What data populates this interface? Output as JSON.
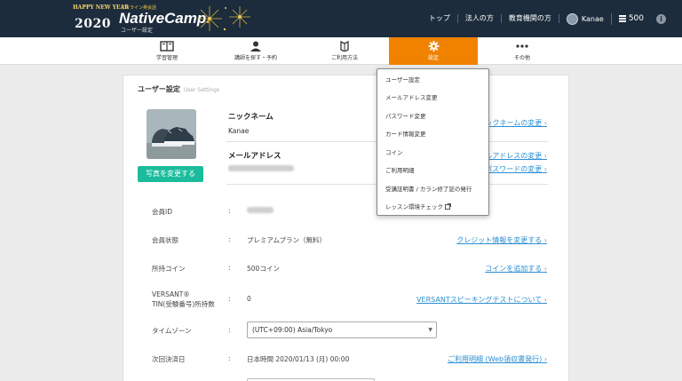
{
  "header": {
    "badge_top": "HAPPY NEW YEAR",
    "badge_year": "2020",
    "brand_tagline": "オンライン英会話",
    "brand_name_main": "NativeCamp",
    "brand_name_dot": ".",
    "brand_sub": "ユーザー設定",
    "links": [
      "トップ",
      "法人の方",
      "教育機関の方"
    ],
    "user_name": "Kanae",
    "coins": "500",
    "info": "i"
  },
  "mainnav": [
    {
      "label": "学習管理",
      "icon": "book-icon"
    },
    {
      "label": "講師を探す・予約",
      "icon": "teacher-icon"
    },
    {
      "label": "ご利用方法",
      "icon": "guide-icon"
    },
    {
      "label": "設定",
      "icon": "gear-icon"
    },
    {
      "label": "その他",
      "icon": "more-icon"
    }
  ],
  "settings": {
    "title": "ユーザー設定",
    "title_en": "User Settings",
    "photo_button": "写真を変更する",
    "nickname_label": "ニックネーム",
    "nickname_value": "Kanae",
    "email_label": "メールアドレス",
    "link_nickname": "ックネームの変更",
    "link_email": "ルアドレスの変更",
    "link_password": "パスワードの変更",
    "rows": [
      {
        "label": "会員ID",
        "value": ""
      },
      {
        "label": "会員状態",
        "value": "プレミアムプラン（無料）",
        "link": "クレジット情報を変更する"
      },
      {
        "label": "所持コイン",
        "value": "500コイン",
        "link": "コインを追加する"
      },
      {
        "label": "VERSANT®",
        "label2": "TIN(受験番号)所持数",
        "value": "0",
        "link": "VERSANTスピーキングテストについて"
      },
      {
        "label": "タイムゾーン",
        "value": "(UTC+09:00) Asia/Tokyo"
      },
      {
        "label": "次回決済日",
        "value": "日本時間 2020/01/13 (月) 00:00",
        "link": "ご利用明細 (Web領収書発行)"
      }
    ],
    "colon": ":"
  },
  "dropdown": [
    "ユーザー設定",
    "メールアドレス変更",
    "パスワード変更",
    "カード情報変更",
    "コイン",
    "ご利用明細",
    "受講証明書 / カラン修了証の発行",
    "レッスン環境チェック"
  ],
  "colors": {
    "header_bg": "#1c2c3c",
    "accent_orange": "#f08200",
    "button_green": "#1abc9c",
    "link_blue": "#2b8fd3"
  }
}
